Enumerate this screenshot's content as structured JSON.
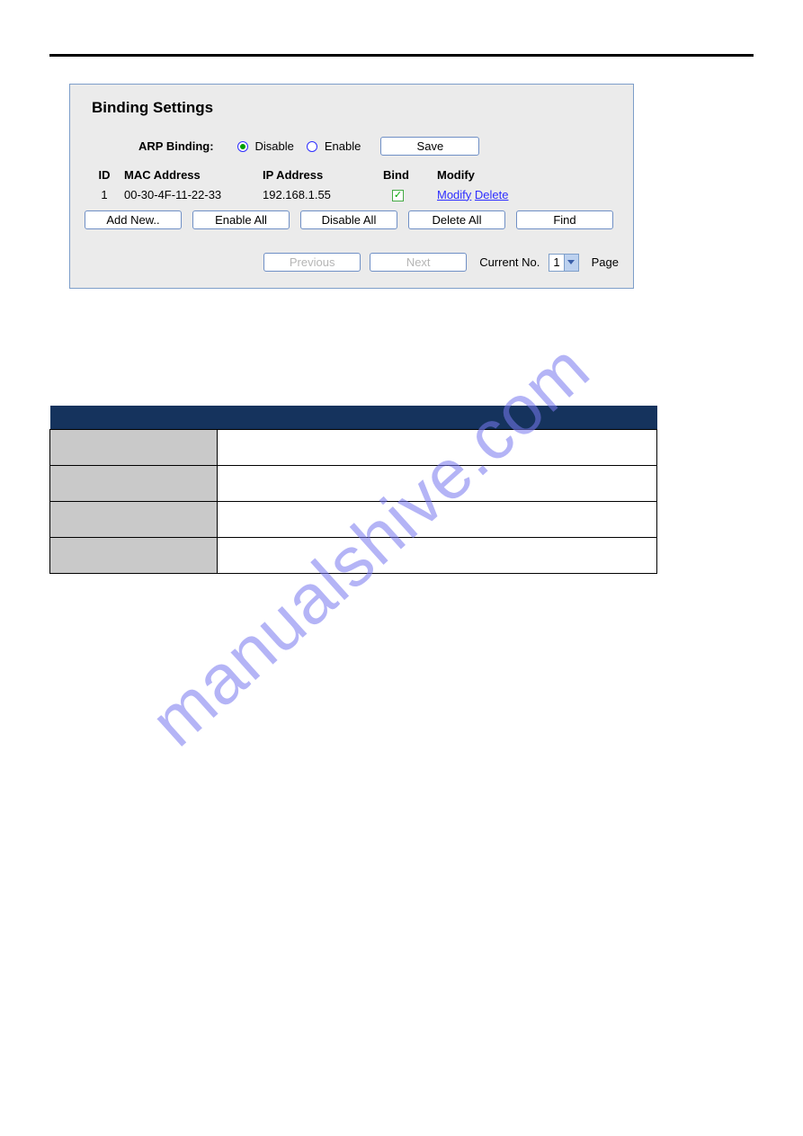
{
  "watermark": "manualshive.com",
  "panel": {
    "title": "Binding Settings",
    "arp_label": "ARP Binding:",
    "disable": "Disable",
    "enable": "Enable",
    "save": "Save",
    "headers": {
      "id": "ID",
      "mac": "MAC Address",
      "ip": "IP Address",
      "bind": "Bind",
      "modify": "Modify"
    },
    "rows": [
      {
        "id": "1",
        "mac": "00-30-4F-11-22-33",
        "ip": "192.168.1.55",
        "bind": true,
        "modify": "Modify",
        "delete": "Delete"
      }
    ],
    "buttons": {
      "add": "Add New..",
      "enable_all": "Enable All",
      "disable_all": "Disable All",
      "delete_all": "Delete All",
      "find": "Find"
    },
    "pager": {
      "previous": "Previous",
      "next": "Next",
      "current_no": "Current No.",
      "page_value": "1",
      "page": "Page"
    }
  },
  "lower_table": {
    "headers": [
      "",
      ""
    ],
    "rows": [
      {
        "label": "",
        "value": ""
      },
      {
        "label": "",
        "value": ""
      },
      {
        "label": "",
        "value": ""
      },
      {
        "label": "",
        "value": ""
      }
    ]
  }
}
